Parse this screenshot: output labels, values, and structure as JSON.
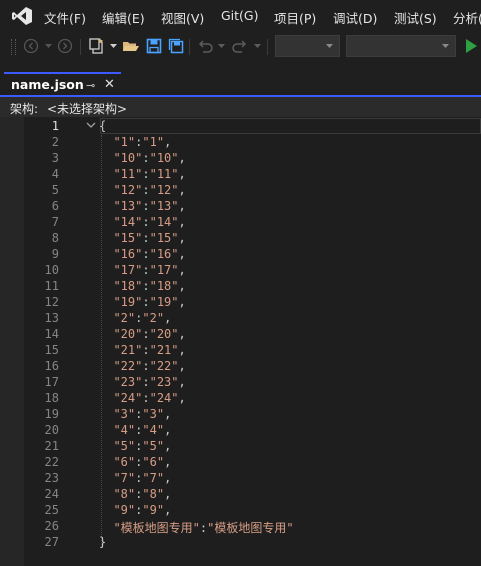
{
  "menu": [
    "文件(F)",
    "编辑(E)",
    "视图(V)",
    "Git(G)",
    "项目(P)",
    "调试(D)",
    "测试(S)",
    "分析("
  ],
  "tab": {
    "title": "name.json",
    "pin": "⊸",
    "close": "✕"
  },
  "schema": {
    "label": "架构:",
    "value": "<未选择架构>"
  },
  "colors": {
    "accent": "#3d5afe",
    "string": "#d69d85",
    "run": "#2ea043"
  },
  "icons": [
    "vs-logo-icon",
    "back-icon",
    "forward-icon",
    "new-project-icon",
    "open-folder-icon",
    "save-icon",
    "save-all-icon",
    "undo-icon",
    "redo-icon",
    "start-debug-icon"
  ],
  "editor": {
    "lines": [
      {
        "n": "1",
        "code": "{"
      },
      {
        "n": "2",
        "code": "  \"1\":\"1\","
      },
      {
        "n": "3",
        "code": "  \"10\":\"10\","
      },
      {
        "n": "4",
        "code": "  \"11\":\"11\","
      },
      {
        "n": "5",
        "code": "  \"12\":\"12\","
      },
      {
        "n": "6",
        "code": "  \"13\":\"13\","
      },
      {
        "n": "7",
        "code": "  \"14\":\"14\","
      },
      {
        "n": "8",
        "code": "  \"15\":\"15\","
      },
      {
        "n": "9",
        "code": "  \"16\":\"16\","
      },
      {
        "n": "10",
        "code": "  \"17\":\"17\","
      },
      {
        "n": "11",
        "code": "  \"18\":\"18\","
      },
      {
        "n": "12",
        "code": "  \"19\":\"19\","
      },
      {
        "n": "13",
        "code": "  \"2\":\"2\","
      },
      {
        "n": "14",
        "code": "  \"20\":\"20\","
      },
      {
        "n": "15",
        "code": "  \"21\":\"21\","
      },
      {
        "n": "16",
        "code": "  \"22\":\"22\","
      },
      {
        "n": "17",
        "code": "  \"23\":\"23\","
      },
      {
        "n": "18",
        "code": "  \"24\":\"24\","
      },
      {
        "n": "19",
        "code": "  \"3\":\"3\","
      },
      {
        "n": "20",
        "code": "  \"4\":\"4\","
      },
      {
        "n": "21",
        "code": "  \"5\":\"5\","
      },
      {
        "n": "22",
        "code": "  \"6\":\"6\","
      },
      {
        "n": "23",
        "code": "  \"7\":\"7\","
      },
      {
        "n": "24",
        "code": "  \"8\":\"8\","
      },
      {
        "n": "25",
        "code": "  \"9\":\"9\","
      },
      {
        "n": "26",
        "code": "  \"模板地图专用\":\"模板地图专用\""
      },
      {
        "n": "27",
        "code": "}"
      }
    ]
  }
}
